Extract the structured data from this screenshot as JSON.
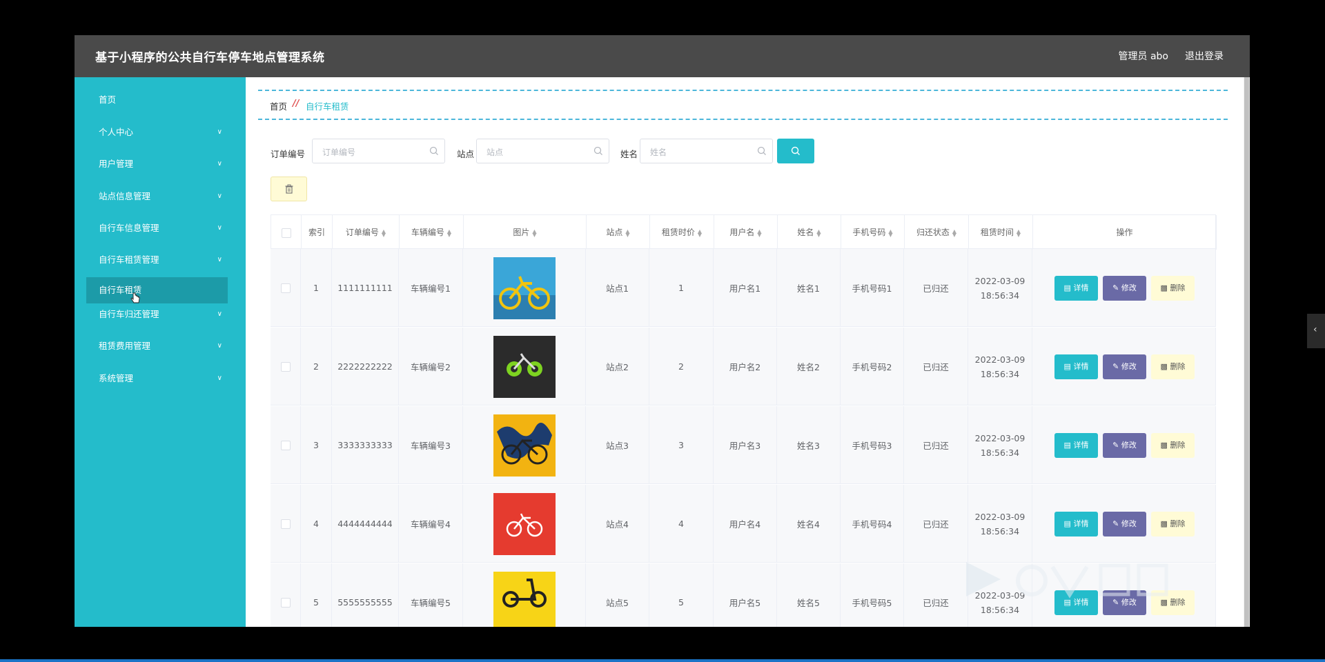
{
  "header": {
    "title": "基于小程序的公共自行车停车地点管理系统",
    "admin": "管理员 abo",
    "logout": "退出登录"
  },
  "sidebar": {
    "items": [
      {
        "label": "首页",
        "expandable": false
      },
      {
        "label": "个人中心",
        "expandable": true
      },
      {
        "label": "用户管理",
        "expandable": true
      },
      {
        "label": "站点信息管理",
        "expandable": true
      },
      {
        "label": "自行车信息管理",
        "expandable": true
      },
      {
        "label": "自行车租赁管理",
        "expandable": true
      },
      {
        "label": "自行车租赁",
        "expandable": false,
        "active": true
      },
      {
        "label": "自行车归还管理",
        "expandable": true
      },
      {
        "label": "租赁费用管理",
        "expandable": true
      },
      {
        "label": "系统管理",
        "expandable": true
      }
    ]
  },
  "breadcrumb": {
    "home": "首页",
    "separator": "//",
    "current": "自行车租赁"
  },
  "filters": {
    "order_label": "订单编号",
    "order_placeholder": "订单编号",
    "station_label": "站点",
    "station_placeholder": "站点",
    "name_label": "姓名",
    "name_placeholder": "姓名"
  },
  "table": {
    "headers": [
      "索引",
      "订单编号",
      "车辆编号",
      "图片",
      "站点",
      "租赁时价",
      "用户名",
      "姓名",
      "手机号码",
      "归还状态",
      "租赁时间",
      "操作"
    ],
    "rows": [
      {
        "index": "1",
        "order": "1111111111",
        "bike": "车辆编号1",
        "image": "yellow-bike",
        "station": "站点1",
        "price": "1",
        "username": "用户名1",
        "name": "姓名1",
        "phone": "手机号码1",
        "status": "已归还",
        "date": "2022-03-09",
        "time": "18:56:34"
      },
      {
        "index": "2",
        "order": "2222222222",
        "bike": "车辆编号2",
        "image": "dark-bike",
        "station": "站点2",
        "price": "2",
        "username": "用户名2",
        "name": "姓名2",
        "phone": "手机号码2",
        "status": "已归还",
        "date": "2022-03-09",
        "time": "18:56:34"
      },
      {
        "index": "3",
        "order": "3333333333",
        "bike": "车辆编号3",
        "image": "map-bike",
        "station": "站点3",
        "price": "3",
        "username": "用户名3",
        "name": "姓名3",
        "phone": "手机号码3",
        "status": "已归还",
        "date": "2022-03-09",
        "time": "18:56:34"
      },
      {
        "index": "4",
        "order": "4444444444",
        "bike": "车辆编号4",
        "image": "red-bike",
        "station": "站点4",
        "price": "4",
        "username": "用户名4",
        "name": "姓名4",
        "phone": "手机号码4",
        "status": "已归还",
        "date": "2022-03-09",
        "time": "18:56:34"
      },
      {
        "index": "5",
        "order": "5555555555",
        "bike": "车辆编号5",
        "image": "scooter",
        "station": "站点5",
        "price": "5",
        "username": "用户名5",
        "name": "姓名5",
        "phone": "手机号码5",
        "status": "已归还",
        "date": "2022-03-09",
        "time": "18:56:34"
      }
    ],
    "actions": {
      "detail": "详情",
      "edit": "修改",
      "delete": "删除"
    }
  },
  "colors": {
    "accent": "#24bccb",
    "sidebar": "#24bccb",
    "header": "#4a4a4a",
    "edit": "#6a6aa6",
    "delete_bg": "#fffbd6"
  }
}
